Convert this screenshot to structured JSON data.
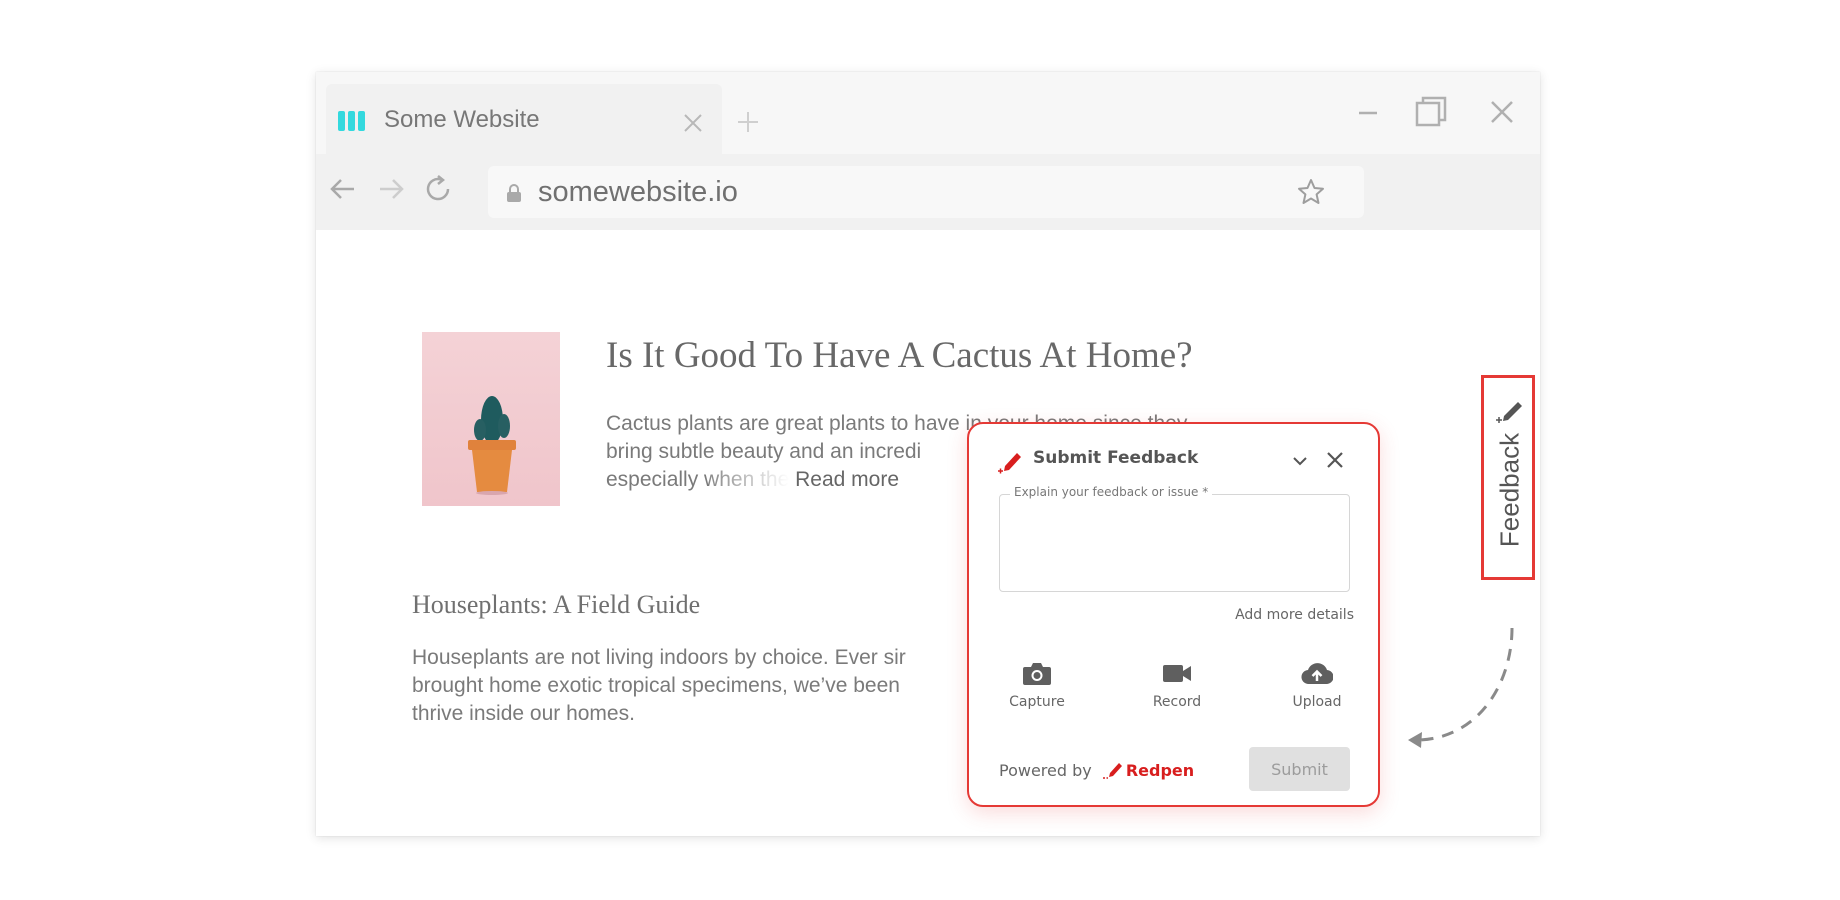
{
  "browser": {
    "tab_title": "Some Website",
    "address": "somewebsite.io"
  },
  "article1": {
    "title": "Is It Good To Have A Cactus At Home?",
    "body_line1": "Cactus plants are great plants to have in your home since they",
    "body_line2": "bring subtle beauty and an incredi",
    "body_line3": "especially when the",
    "read_more": "Read more"
  },
  "article2": {
    "title": "Houseplants: A Field Guide",
    "body_line1": "Houseplants are not living indoors by choice. Ever sir",
    "body_line2": "brought home exotic tropical specimens, we’ve been",
    "body_line3": "thrive inside our homes."
  },
  "feedback_tab": {
    "label": "Feedback"
  },
  "widget": {
    "title": "Submit Feedback",
    "textarea_label": "Explain your feedback or issue *",
    "add_more": "Add more details",
    "actions": [
      {
        "label": "Capture",
        "icon": "camera-icon"
      },
      {
        "label": "Record",
        "icon": "video-icon"
      },
      {
        "label": "Upload",
        "icon": "cloud-upload-icon"
      }
    ],
    "powered_by": "Powered by",
    "brand": "Redpen",
    "submit": "Submit"
  },
  "colors": {
    "accent": "#e53935",
    "brand": "#d81e1e",
    "logo": "#33d9de"
  }
}
